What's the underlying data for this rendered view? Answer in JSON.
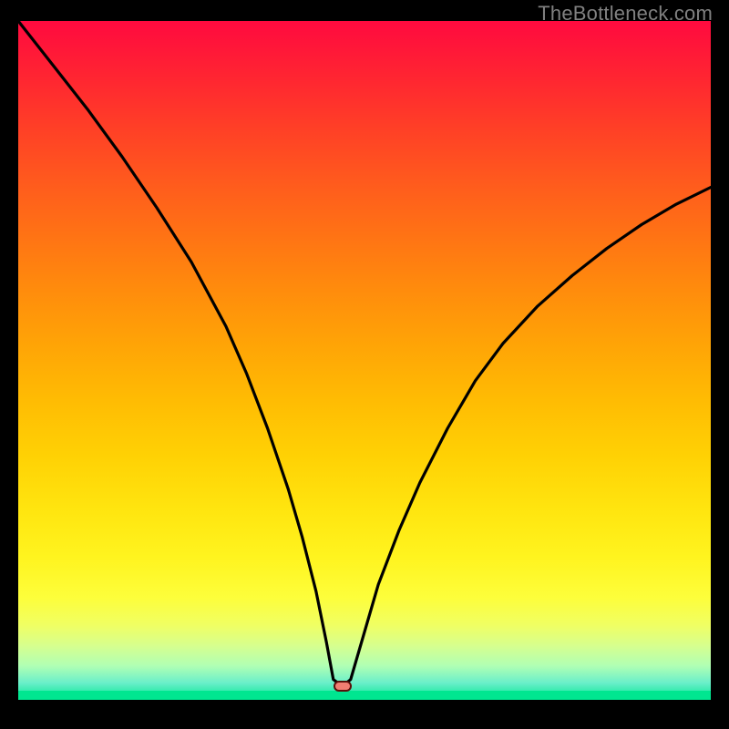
{
  "attribution": "TheBottleneck.com",
  "colors": {
    "marker_fill": "#f17e72",
    "marker_border": "#5b0f0a",
    "curve": "#000000"
  },
  "chart_data": {
    "type": "line",
    "title": "",
    "xlabel": "",
    "ylabel": "",
    "xlim": [
      0,
      100
    ],
    "ylim": [
      0,
      100
    ],
    "series": [
      {
        "name": "bottleneck-curve",
        "x": [
          0,
          5,
          10,
          15,
          20,
          25,
          30,
          33,
          36,
          39,
          41,
          43,
          44.5,
          45.5,
          46.8,
          48,
          50,
          52,
          55,
          58,
          62,
          66,
          70,
          75,
          80,
          85,
          90,
          95,
          100
        ],
        "values": [
          100,
          93.5,
          87,
          80,
          72.5,
          64.5,
          55,
          48,
          40,
          31,
          24,
          16,
          8.5,
          3,
          2,
          3,
          10,
          17,
          25,
          32,
          40,
          47,
          52.5,
          58,
          62.5,
          66.5,
          70,
          73,
          75.5
        ]
      }
    ],
    "marker": {
      "x": 46.8,
      "y": 2
    },
    "gradient_note": "vertical hue ramp red->green signifies bottleneck severity (red=high, green=low)"
  }
}
